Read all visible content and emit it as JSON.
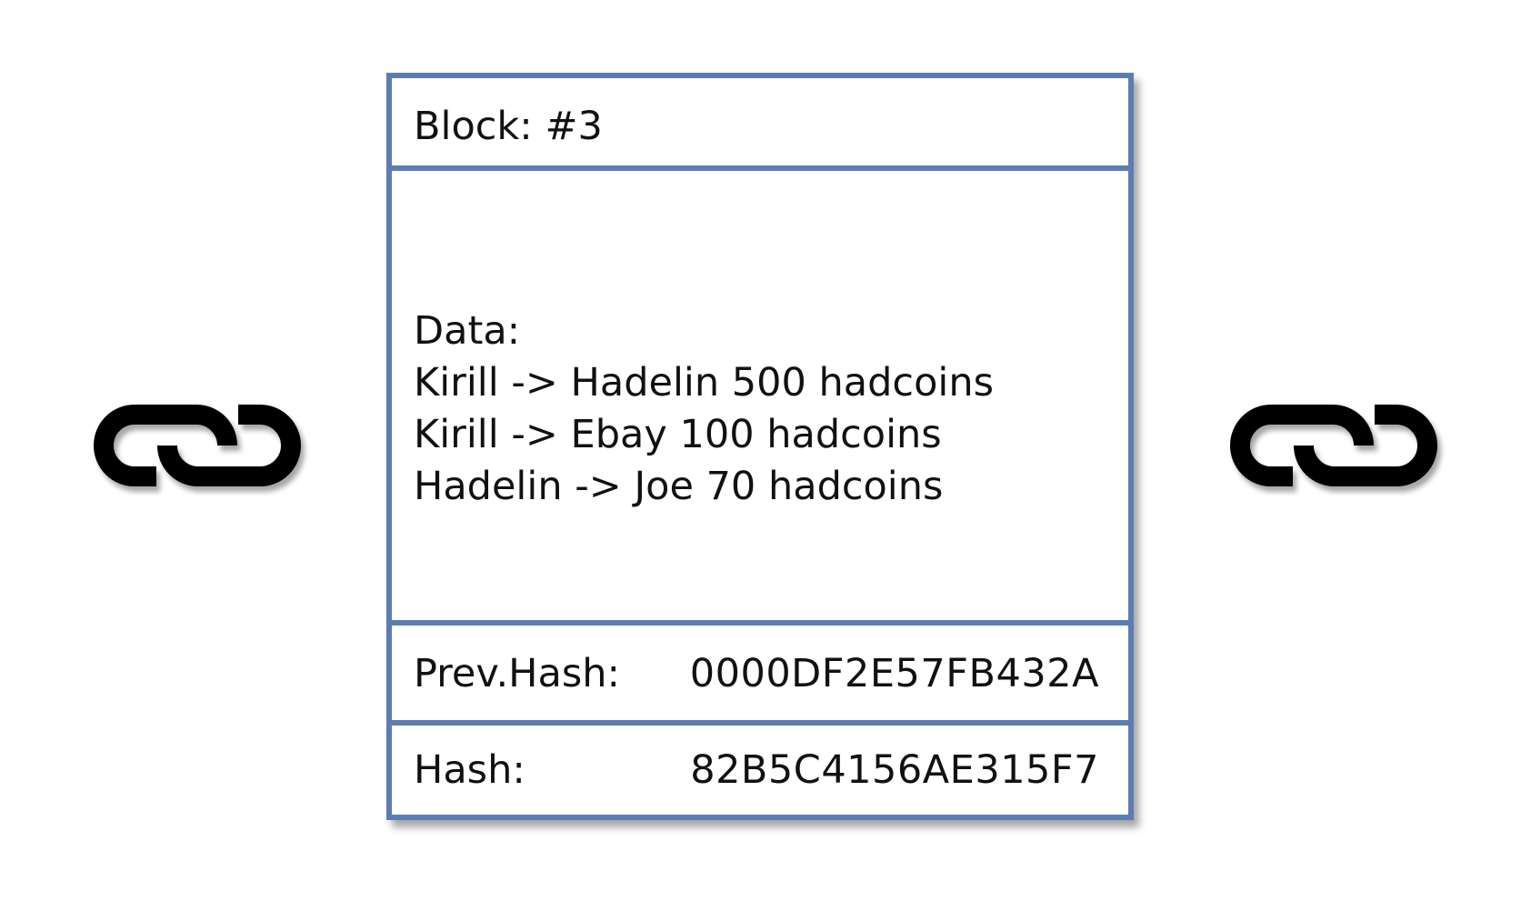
{
  "icons": {
    "left": "chain-link-icon",
    "right": "chain-link-icon"
  },
  "colors": {
    "border": "#5b7db1",
    "text": "#111111",
    "icon": "#000000"
  },
  "block": {
    "title": "Block: #3",
    "data_label": "Data:",
    "data_lines": [
      "Kirill -> Hadelin 500 hadcoins",
      "Kirill -> Ebay 100 hadcoins",
      "Hadelin -> Joe 70 hadcoins"
    ],
    "prev_hash_label": "Prev.Hash:",
    "prev_hash_value": "0000DF2E57FB432A",
    "hash_label": "Hash:",
    "hash_value": "82B5C4156AE315F7"
  }
}
